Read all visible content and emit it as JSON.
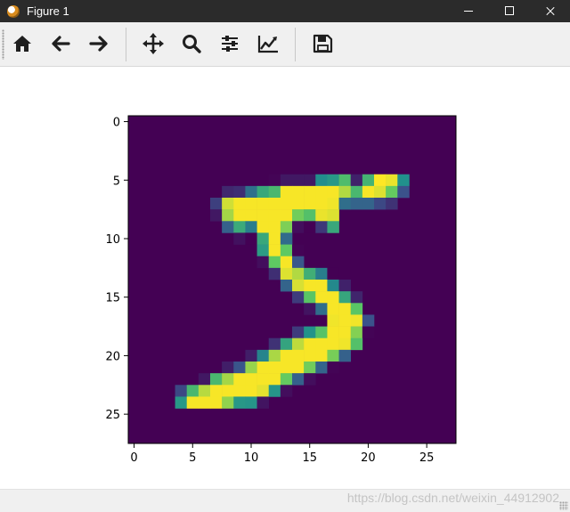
{
  "window": {
    "title": "Figure 1",
    "app_icon": "matplotlib-icon",
    "controls": [
      "minimize-icon",
      "maximize-icon",
      "close-icon"
    ]
  },
  "toolbar": {
    "buttons": [
      {
        "name": "home-button",
        "icon": "home-icon"
      },
      {
        "name": "back-button",
        "icon": "arrow-left-icon"
      },
      {
        "name": "forward-button",
        "icon": "arrow-right-icon"
      },
      {
        "name": "pan-button",
        "icon": "move-icon"
      },
      {
        "name": "zoom-button",
        "icon": "magnifier-icon"
      },
      {
        "name": "configure-subplots-button",
        "icon": "sliders-icon"
      },
      {
        "name": "edit-axes-button",
        "icon": "line-chart-icon"
      },
      {
        "name": "save-button",
        "icon": "floppy-disk-icon"
      }
    ]
  },
  "chart_data": {
    "type": "heatmap",
    "colormap": "viridis",
    "title": "",
    "xlabel": "",
    "ylabel": "",
    "xlim": [
      -0.5,
      27.5
    ],
    "ylim": [
      27.5,
      -0.5
    ],
    "xticks": [
      0,
      5,
      10,
      15,
      20,
      25
    ],
    "yticks": [
      0,
      5,
      10,
      15,
      20,
      25
    ],
    "rows": 28,
    "cols": 28,
    "nonzero_pixels": [
      {
        "row": 5,
        "cols_from": 12,
        "values": [
          0.01,
          0.07,
          0.07,
          0.07,
          0.49,
          0.53,
          0.69,
          0.1,
          0.65,
          1.0,
          0.97,
          0.5
        ]
      },
      {
        "row": 6,
        "cols_from": 8,
        "values": [
          0.12,
          0.14,
          0.37,
          0.6,
          0.67,
          0.99,
          0.99,
          0.99,
          0.99,
          0.99,
          0.88,
          0.67,
          0.99,
          0.95,
          0.76,
          0.25
        ]
      },
      {
        "row": 7,
        "cols_from": 7,
        "values": [
          0.19,
          0.93,
          0.99,
          0.99,
          0.99,
          0.99,
          0.99,
          0.99,
          0.99,
          0.99,
          0.98,
          0.36,
          0.32,
          0.32,
          0.22,
          0.15
        ]
      },
      {
        "row": 8,
        "cols_from": 7,
        "values": [
          0.07,
          0.86,
          0.99,
          0.99,
          0.99,
          0.99,
          0.99,
          0.78,
          0.71,
          0.97,
          0.95
        ]
      },
      {
        "row": 9,
        "cols_from": 8,
        "values": [
          0.31,
          0.61,
          0.42,
          0.99,
          0.99,
          0.8,
          0.04,
          0.0,
          0.17,
          0.6
        ]
      },
      {
        "row": 10,
        "cols_from": 9,
        "values": [
          0.05,
          0.0,
          0.6,
          0.99,
          0.35
        ]
      },
      {
        "row": 11,
        "cols_from": 11,
        "values": [
          0.55,
          0.99,
          0.75,
          0.01
        ]
      },
      {
        "row": 12,
        "cols_from": 11,
        "values": [
          0.04,
          0.75,
          0.99,
          0.27
        ]
      },
      {
        "row": 13,
        "cols_from": 12,
        "values": [
          0.14,
          0.95,
          0.88,
          0.63,
          0.42,
          0.0
        ]
      },
      {
        "row": 14,
        "cols_from": 13,
        "values": [
          0.32,
          0.94,
          0.99,
          0.99,
          0.47,
          0.1
        ]
      },
      {
        "row": 15,
        "cols_from": 14,
        "values": [
          0.18,
          0.73,
          0.99,
          0.99,
          0.59,
          0.11
        ]
      },
      {
        "row": 16,
        "cols_from": 15,
        "values": [
          0.06,
          0.36,
          0.99,
          0.99,
          0.73
        ]
      },
      {
        "row": 17,
        "cols_from": 17,
        "values": [
          0.98,
          0.99,
          0.98,
          0.25
        ]
      },
      {
        "row": 18,
        "cols_from": 14,
        "values": [
          0.18,
          0.51,
          0.72,
          0.99,
          0.99,
          0.81,
          0.01
        ]
      },
      {
        "row": 19,
        "cols_from": 12,
        "values": [
          0.15,
          0.58,
          0.9,
          0.99,
          0.99,
          0.99,
          0.98,
          0.71
        ]
      },
      {
        "row": 20,
        "cols_from": 10,
        "values": [
          0.09,
          0.45,
          0.87,
          0.99,
          0.99,
          0.99,
          0.99,
          0.79,
          0.31
        ]
      },
      {
        "row": 21,
        "cols_from": 8,
        "values": [
          0.09,
          0.26,
          0.84,
          0.99,
          0.99,
          0.99,
          0.99,
          0.78,
          0.32,
          0.01
        ]
      },
      {
        "row": 22,
        "cols_from": 6,
        "values": [
          0.07,
          0.67,
          0.86,
          0.99,
          0.99,
          0.99,
          0.99,
          0.76,
          0.31,
          0.04
        ]
      },
      {
        "row": 23,
        "cols_from": 4,
        "values": [
          0.22,
          0.67,
          0.89,
          0.99,
          0.99,
          0.99,
          0.99,
          0.96,
          0.52,
          0.04
        ]
      },
      {
        "row": 24,
        "cols_from": 4,
        "values": [
          0.53,
          0.99,
          0.99,
          0.99,
          0.83,
          0.53,
          0.52,
          0.06
        ]
      }
    ]
  },
  "statusbar": {
    "watermark": "https://blog.csdn.net/weixin_44912902"
  },
  "colors": {
    "titlebar": "#2b2b2b",
    "toolbar": "#f0f0f0",
    "icon": "#1f1f1f"
  }
}
